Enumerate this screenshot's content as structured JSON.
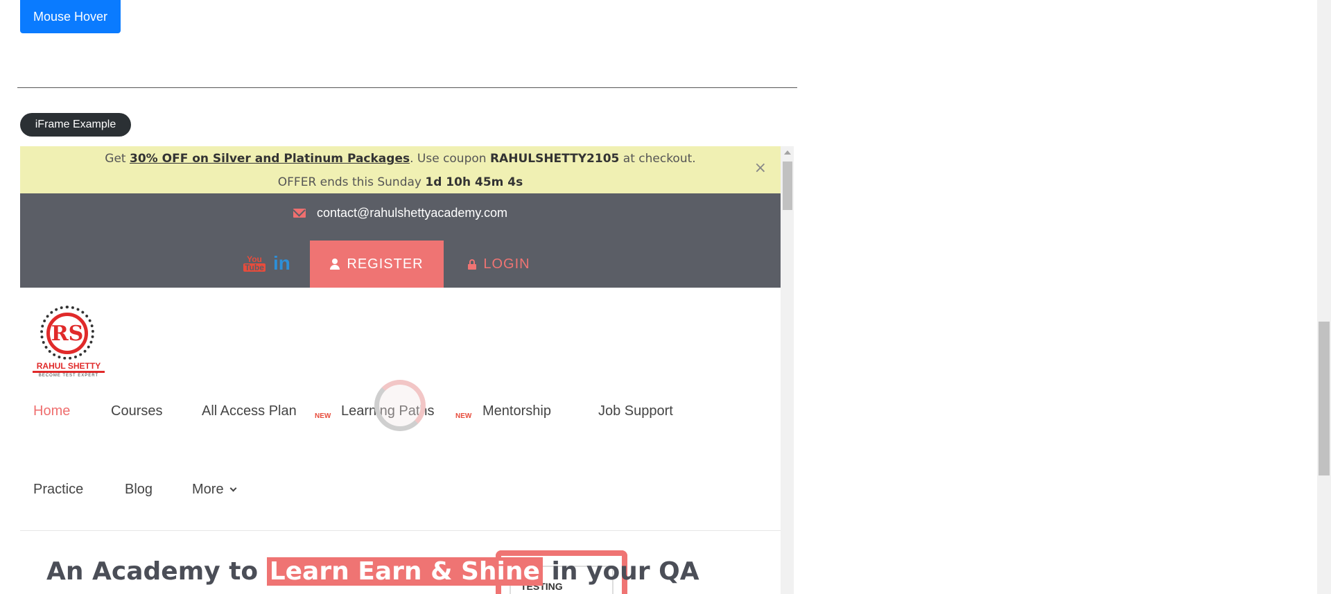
{
  "outer": {
    "mouse_hover_label": "Mouse Hover",
    "iframe_label": "iFrame Example",
    "accent": "#0a7bff"
  },
  "iframe": {
    "promo": {
      "get": "Get",
      "offer_link": "30% OFF on Silver and Platinum Packages",
      "use_coupon": ". Use coupon",
      "coupon": "RAHULSHETTY2105",
      "at_checkout": "at checkout.",
      "ends_text": "OFFER ends this Sunday",
      "countdown": "1d 10h 45m 4s",
      "close": "×"
    },
    "topbar": {
      "email": "contact@rahulshettyacademy.com",
      "youtube_you": "You",
      "youtube_tube": "Tube",
      "linkedin": "in",
      "register": "REGISTER",
      "login": "LOGIN"
    },
    "logo": {
      "mark": "RS",
      "name": "RAHUL SHETTY",
      "tagline": "BECOME TEST EXPERT"
    },
    "nav": {
      "home": "Home",
      "courses": "Courses",
      "all_access": "All Access Plan",
      "learning_paths": "Learning Paths",
      "mentorship": "Mentorship",
      "job_support": "Job Support",
      "practice": "Practice",
      "blog": "Blog",
      "more": "More",
      "new_badge": "NEW"
    },
    "hero": {
      "prefix": "An Academy to",
      "highlight": "Learn Earn & Shine",
      "suffix": "in your QA",
      "art_text": "TESTING"
    },
    "brand_color": "#ef7473"
  }
}
